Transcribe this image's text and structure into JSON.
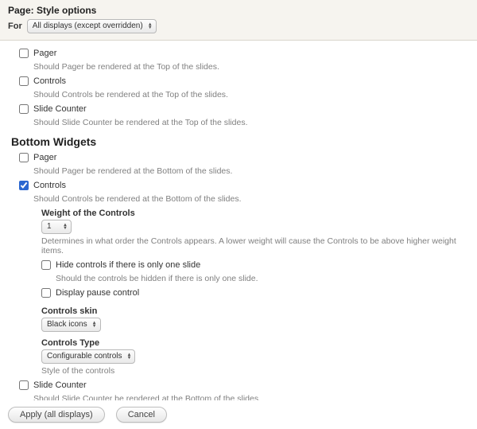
{
  "header": {
    "title": "Page: Style options",
    "for_label": "For",
    "for_select": "All displays (except overridden)"
  },
  "top_widgets": {
    "pager": {
      "label": "Pager",
      "desc": "Should Pager be rendered at the Top of the slides.",
      "checked": false
    },
    "controls": {
      "label": "Controls",
      "desc": "Should Controls be rendered at the Top of the slides.",
      "checked": false
    },
    "slide_counter": {
      "label": "Slide Counter",
      "desc": "Should Slide Counter be rendered at the Top of the slides.",
      "checked": false
    }
  },
  "bottom_widgets": {
    "section_title": "Bottom Widgets",
    "pager": {
      "label": "Pager",
      "desc": "Should Pager be rendered at the Bottom of the slides.",
      "checked": false
    },
    "controls": {
      "label": "Controls",
      "desc": "Should Controls be rendered at the Bottom of the slides.",
      "checked": true,
      "weight": {
        "title": "Weight of the Controls",
        "value": "1",
        "desc": "Determines in what order the Controls appears. A lower weight will cause the Controls to be above higher weight items."
      },
      "hide_one": {
        "label": "Hide controls if there is only one slide",
        "desc": "Should the controls be hidden if there is only one slide.",
        "checked": false
      },
      "pause": {
        "label": "Display pause control",
        "checked": false
      },
      "skin": {
        "title": "Controls skin",
        "value": "Black icons"
      },
      "type": {
        "title": "Controls Type",
        "value": "Configurable controls",
        "desc": "Style of the controls"
      }
    },
    "slide_counter": {
      "label": "Slide Counter",
      "desc": "Should Slide Counter be rendered at the Bottom of the slides.",
      "checked": false
    }
  },
  "footer": {
    "apply": "Apply (all displays)",
    "cancel": "Cancel"
  }
}
